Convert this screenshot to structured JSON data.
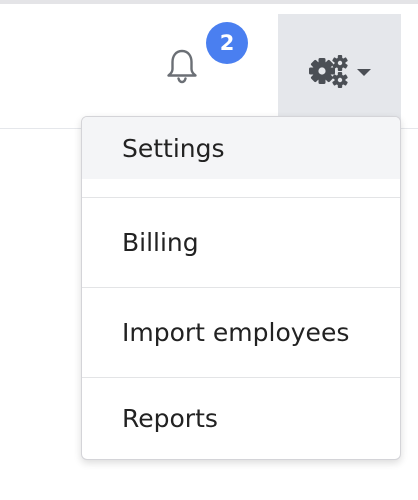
{
  "header": {
    "notifications": {
      "icon": "bell-icon",
      "count": "2",
      "badge_color": "#4a7ff0"
    },
    "settings_toggle": {
      "icon": "gears-icon",
      "caret_icon": "caret-down-icon",
      "background": "#e5e7eb"
    }
  },
  "dropdown": {
    "items": [
      {
        "label": "Settings",
        "active": true
      },
      {
        "label": "Billing"
      },
      {
        "label": "Import employees"
      },
      {
        "label": "Reports"
      }
    ]
  }
}
